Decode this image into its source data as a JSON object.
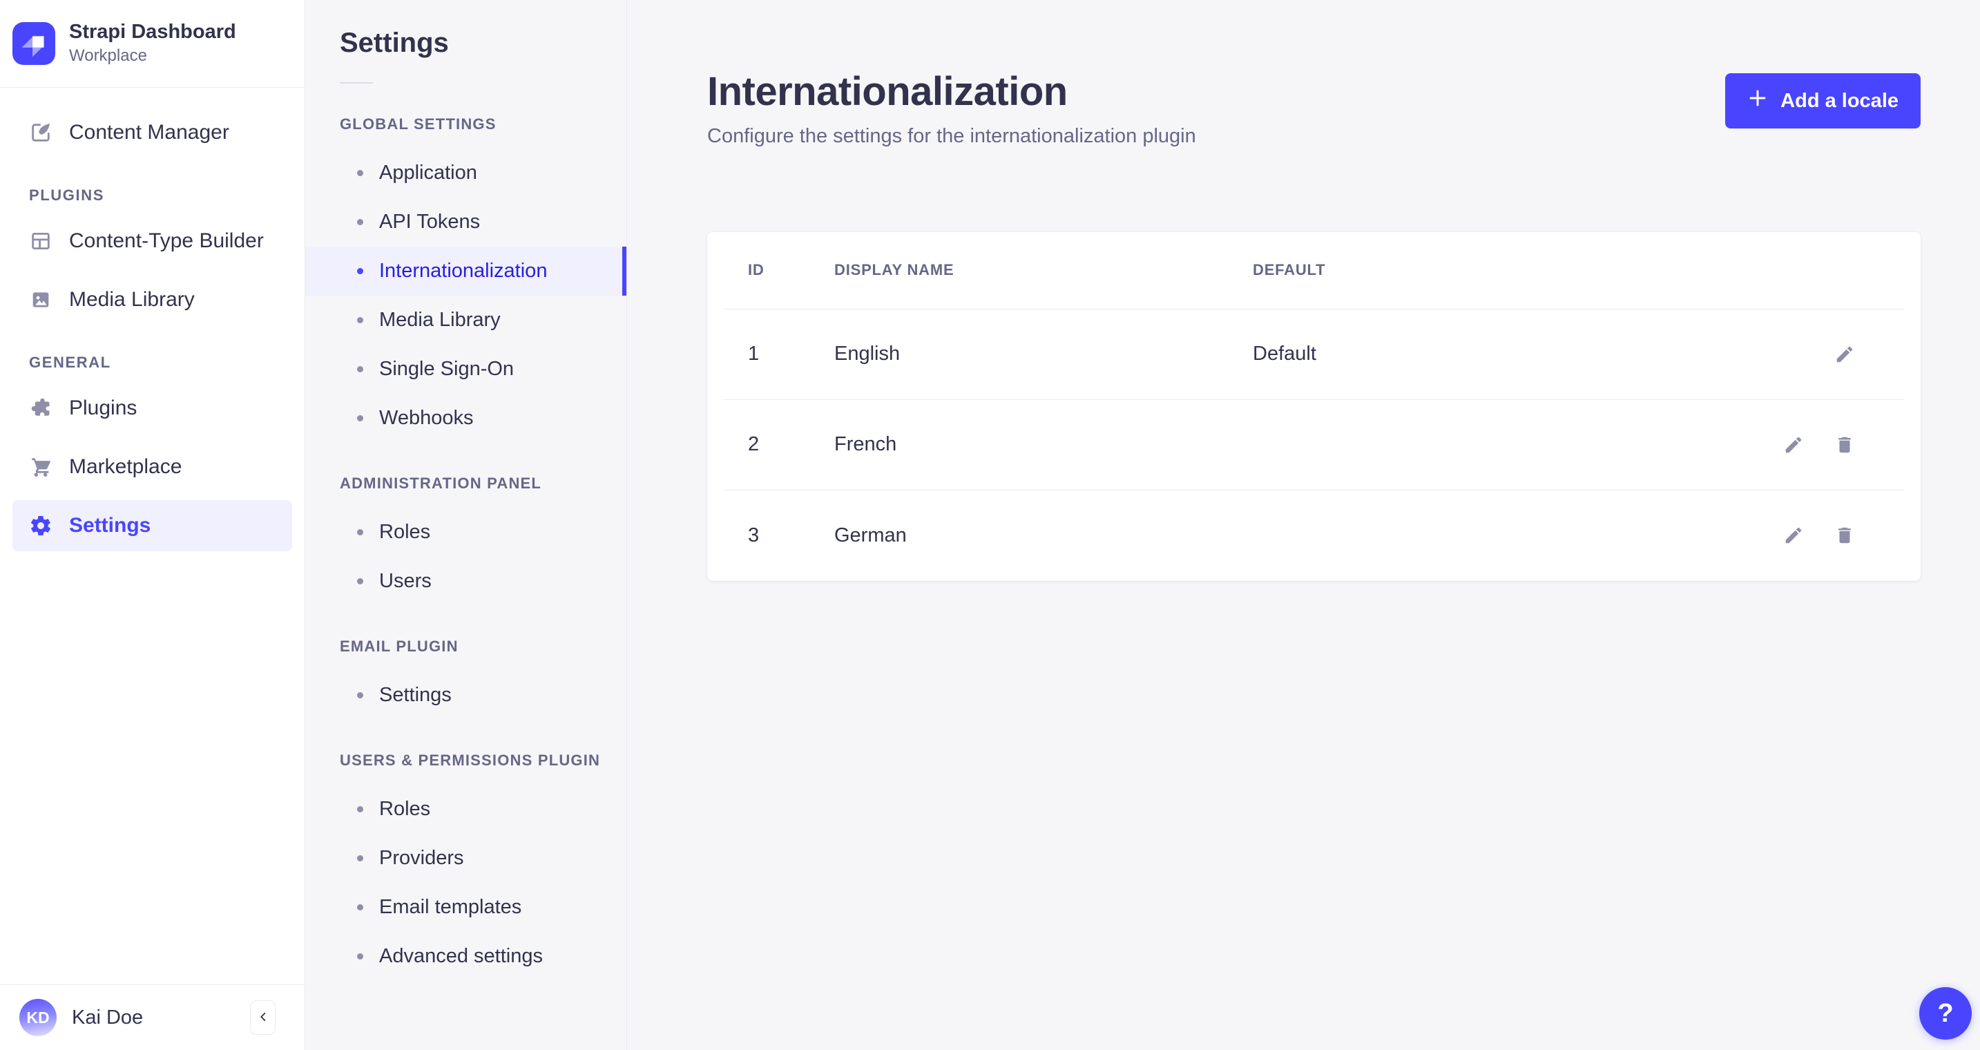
{
  "colors": {
    "primary": "#4945ff",
    "primary_light_bg": "#f0f0ff",
    "selected_link_text": "#271fe0",
    "text_dark": "#32324d",
    "text_muted": "#666687",
    "icon_gray": "#8e8ea9",
    "border": "#eaeaef",
    "page_bg": "#f6f6f9"
  },
  "brand": {
    "title": "Strapi Dashboard",
    "subtitle": "Workplace"
  },
  "mainnav": {
    "sections": [
      {
        "label": "",
        "items": [
          {
            "label": "Content Manager",
            "icon": "pen-icon",
            "selected": false
          }
        ]
      },
      {
        "label": "PLUGINS",
        "items": [
          {
            "label": "Content-Type Builder",
            "icon": "layout-icon",
            "selected": false
          },
          {
            "label": "Media Library",
            "icon": "image-icon",
            "selected": false
          }
        ]
      },
      {
        "label": "GENERAL",
        "items": [
          {
            "label": "Plugins",
            "icon": "puzzle-icon",
            "selected": false
          },
          {
            "label": "Marketplace",
            "icon": "cart-icon",
            "selected": false
          },
          {
            "label": "Settings",
            "icon": "gear-icon",
            "selected": true
          }
        ]
      }
    ],
    "user": {
      "initials": "KD",
      "name": "Kai Doe"
    }
  },
  "subnav": {
    "title": "Settings",
    "sections": [
      {
        "label": "GLOBAL SETTINGS",
        "items": [
          {
            "label": "Application",
            "selected": false
          },
          {
            "label": "API Tokens",
            "selected": false
          },
          {
            "label": "Internationalization",
            "selected": true
          },
          {
            "label": "Media Library",
            "selected": false
          },
          {
            "label": "Single Sign-On",
            "selected": false
          },
          {
            "label": "Webhooks",
            "selected": false
          }
        ]
      },
      {
        "label": "ADMINISTRATION PANEL",
        "items": [
          {
            "label": "Roles",
            "selected": false
          },
          {
            "label": "Users",
            "selected": false
          }
        ]
      },
      {
        "label": "EMAIL PLUGIN",
        "items": [
          {
            "label": "Settings",
            "selected": false
          }
        ]
      },
      {
        "label": "USERS & PERMISSIONS PLUGIN",
        "items": [
          {
            "label": "Roles",
            "selected": false
          },
          {
            "label": "Providers",
            "selected": false
          },
          {
            "label": "Email templates",
            "selected": false
          },
          {
            "label": "Advanced settings",
            "selected": false
          }
        ]
      }
    ]
  },
  "main": {
    "title": "Internationalization",
    "subtitle": "Configure the settings for the internationalization plugin",
    "add_button_label": "Add a locale",
    "table": {
      "headers": {
        "id": "ID",
        "display_name": "DISPLAY NAME",
        "default": "DEFAULT"
      },
      "rows": [
        {
          "id": "1",
          "display_name": "English",
          "default": "Default"
        },
        {
          "id": "2",
          "display_name": "French",
          "default": ""
        },
        {
          "id": "3",
          "display_name": "German",
          "default": ""
        }
      ]
    },
    "help_label": "?"
  }
}
